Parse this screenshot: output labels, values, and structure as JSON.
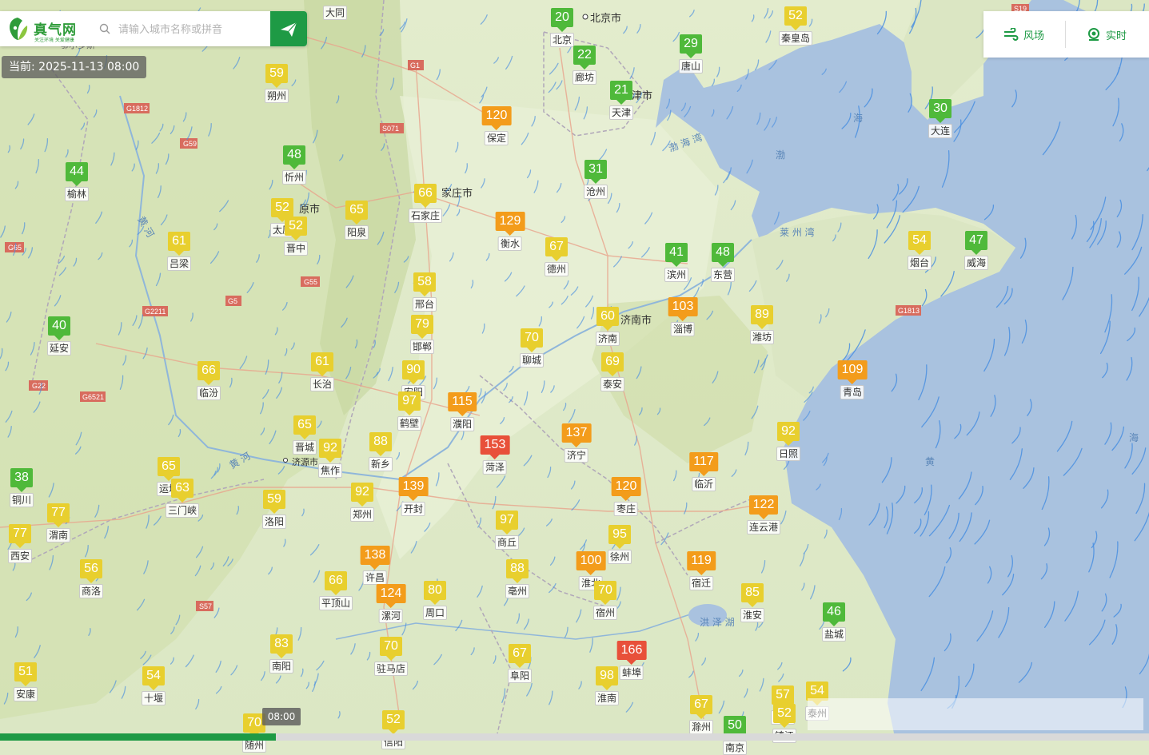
{
  "search": {
    "logo_text": "真气网",
    "logo_sub": "关注环境 关爱健康",
    "placeholder": "请输入城市名称或拼音"
  },
  "current_time_label": "当前: 2025-11-13 08:00",
  "timeline": {
    "marker": "08:00",
    "progress": 0.24
  },
  "controls": {
    "wind_label": "风场",
    "realtime_label": "实时"
  },
  "colors": {
    "good": "#4fb93a",
    "moderate": "#e8cf2e",
    "light": "#f39c1b",
    "medium": "#e8503a",
    "brand": "#1e9a45",
    "sea": "#a9c2df",
    "land": "#dfe9c9",
    "wind": "#4a8fe0"
  },
  "map_labels": [
    "北京市",
    "天津市",
    "家庄市",
    "原市",
    "济南市",
    "渤海湾",
    "莱州湾",
    "渤",
    "海",
    "黄",
    "黄河",
    "洪泽湖",
    "G18",
    "G55",
    "G5",
    "G65",
    "G22",
    "G5521"
  ],
  "stations": [
    {
      "name": "大同",
      "aqi": "",
      "level": "moderate"
    },
    {
      "name": "北京",
      "aqi": "20",
      "level": "good"
    },
    {
      "name": "秦皇岛",
      "aqi": "52",
      "level": "moderate"
    },
    {
      "name": "廊坊",
      "aqi": "22",
      "level": "good"
    },
    {
      "name": "唐山",
      "aqi": "29",
      "level": "good"
    },
    {
      "name": "朔州",
      "aqi": "59",
      "level": "moderate"
    },
    {
      "name": "天津",
      "aqi": "21",
      "level": "good"
    },
    {
      "name": "保定",
      "aqi": "120",
      "level": "light"
    },
    {
      "name": "大连",
      "aqi": "30",
      "level": "good"
    },
    {
      "name": "忻州",
      "aqi": "48",
      "level": "good"
    },
    {
      "name": "榆林",
      "aqi": "44",
      "level": "good"
    },
    {
      "name": "沧州",
      "aqi": "31",
      "level": "good"
    },
    {
      "name": "石家庄",
      "aqi": "66",
      "level": "moderate"
    },
    {
      "name": "太原",
      "aqi": "52",
      "level": "moderate"
    },
    {
      "name": "晋中",
      "aqi": "52",
      "level": "moderate"
    },
    {
      "name": "阳泉",
      "aqi": "65",
      "level": "moderate"
    },
    {
      "name": "衡水",
      "aqi": "129",
      "level": "light"
    },
    {
      "name": "吕梁",
      "aqi": "61",
      "level": "moderate"
    },
    {
      "name": "德州",
      "aqi": "67",
      "level": "moderate"
    },
    {
      "name": "滨州",
      "aqi": "41",
      "level": "good"
    },
    {
      "name": "东营",
      "aqi": "48",
      "level": "good"
    },
    {
      "name": "烟台",
      "aqi": "54",
      "level": "moderate"
    },
    {
      "name": "威海",
      "aqi": "47",
      "level": "good"
    },
    {
      "name": "邢台",
      "aqi": "58",
      "level": "moderate"
    },
    {
      "name": "淄博",
      "aqi": "103",
      "level": "light"
    },
    {
      "name": "延安",
      "aqi": "40",
      "level": "good"
    },
    {
      "name": "济南",
      "aqi": "60",
      "level": "moderate"
    },
    {
      "name": "潍坊",
      "aqi": "89",
      "level": "moderate"
    },
    {
      "name": "邯郸",
      "aqi": "79",
      "level": "moderate"
    },
    {
      "name": "聊城",
      "aqi": "70",
      "level": "moderate"
    },
    {
      "name": "临汾",
      "aqi": "66",
      "level": "moderate"
    },
    {
      "name": "长治",
      "aqi": "61",
      "level": "moderate"
    },
    {
      "name": "安阳",
      "aqi": "90",
      "level": "moderate"
    },
    {
      "name": "泰安",
      "aqi": "69",
      "level": "moderate"
    },
    {
      "name": "青岛",
      "aqi": "109",
      "level": "light"
    },
    {
      "name": "鹤壁",
      "aqi": "97",
      "level": "moderate"
    },
    {
      "name": "濮阳",
      "aqi": "115",
      "level": "light"
    },
    {
      "name": "晋城",
      "aqi": "65",
      "level": "moderate"
    },
    {
      "name": "焦作",
      "aqi": "92",
      "level": "moderate"
    },
    {
      "name": "新乡",
      "aqi": "88",
      "level": "moderate"
    },
    {
      "name": "菏泽",
      "aqi": "153",
      "level": "medium"
    },
    {
      "name": "济宁",
      "aqi": "137",
      "level": "light"
    },
    {
      "name": "日照",
      "aqi": "92",
      "level": "moderate"
    },
    {
      "name": "铜川",
      "aqi": "38",
      "level": "good"
    },
    {
      "name": "运城",
      "aqi": "65",
      "level": "moderate"
    },
    {
      "name": "三门峡",
      "aqi": "63",
      "level": "moderate"
    },
    {
      "name": "临沂",
      "aqi": "117",
      "level": "light"
    },
    {
      "name": "郑州",
      "aqi": "92",
      "level": "moderate"
    },
    {
      "name": "开封",
      "aqi": "139",
      "level": "light"
    },
    {
      "name": "洛阳",
      "aqi": "59",
      "level": "moderate"
    },
    {
      "name": "枣庄",
      "aqi": "120",
      "level": "light"
    },
    {
      "name": "连云港",
      "aqi": "122",
      "level": "light"
    },
    {
      "name": "渭南",
      "aqi": "77",
      "level": "moderate"
    },
    {
      "name": "西安",
      "aqi": "77",
      "level": "moderate"
    },
    {
      "name": "商丘",
      "aqi": "97",
      "level": "moderate"
    },
    {
      "name": "徐州",
      "aqi": "95",
      "level": "moderate"
    },
    {
      "name": "许昌",
      "aqi": "138",
      "level": "light"
    },
    {
      "name": "平顶山",
      "aqi": "66",
      "level": "moderate"
    },
    {
      "name": "商洛",
      "aqi": "56",
      "level": "moderate"
    },
    {
      "name": "亳州",
      "aqi": "88",
      "level": "moderate"
    },
    {
      "name": "淮北",
      "aqi": "100",
      "level": "light"
    },
    {
      "name": "宿迁",
      "aqi": "119",
      "level": "light"
    },
    {
      "name": "漯河",
      "aqi": "124",
      "level": "light"
    },
    {
      "name": "周口",
      "aqi": "80",
      "level": "moderate"
    },
    {
      "name": "宿州",
      "aqi": "70",
      "level": "moderate"
    },
    {
      "name": "淮安",
      "aqi": "85",
      "level": "moderate"
    },
    {
      "name": "盐城",
      "aqi": "46",
      "level": "good"
    },
    {
      "name": "南阳",
      "aqi": "83",
      "level": "moderate"
    },
    {
      "name": "驻马店",
      "aqi": "70",
      "level": "moderate"
    },
    {
      "name": "阜阳",
      "aqi": "67",
      "level": "moderate"
    },
    {
      "name": "蚌埠",
      "aqi": "166",
      "level": "medium"
    },
    {
      "name": "淮南",
      "aqi": "98",
      "level": "moderate"
    },
    {
      "name": "安康",
      "aqi": "51",
      "level": "moderate"
    },
    {
      "name": "十堰",
      "aqi": "54",
      "level": "moderate"
    },
    {
      "name": "滁州",
      "aqi": "67",
      "level": "moderate"
    },
    {
      "name": "扬州",
      "aqi": "57",
      "level": "moderate"
    },
    {
      "name": "泰州",
      "aqi": "54",
      "level": "moderate"
    },
    {
      "name": "镇江",
      "aqi": "52",
      "level": "moderate"
    },
    {
      "name": "南京",
      "aqi": "50",
      "level": "good"
    },
    {
      "name": "信阳",
      "aqi": "52",
      "level": "moderate"
    },
    {
      "name": "随州",
      "aqi": "70",
      "level": "moderate"
    }
  ]
}
